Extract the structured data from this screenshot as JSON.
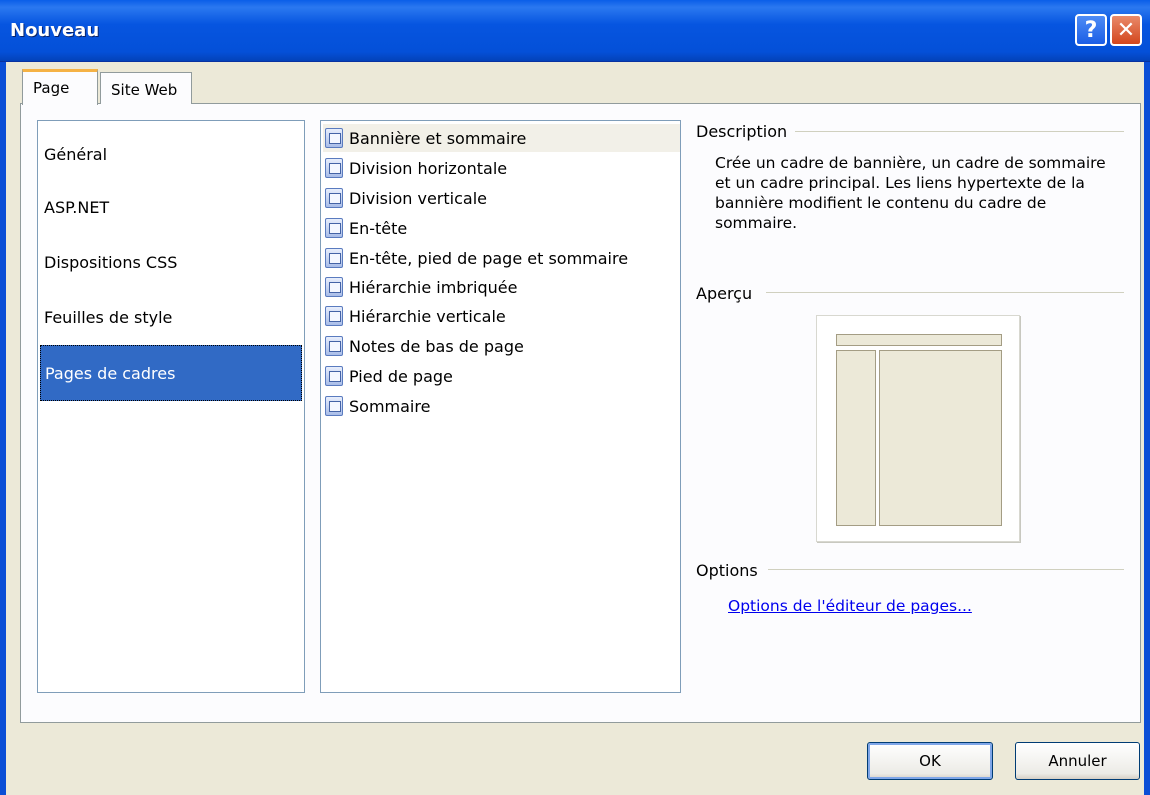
{
  "window": {
    "title": "Nouveau",
    "help_label": "?",
    "close_label": "✕"
  },
  "tabs": [
    {
      "label": "Page",
      "selected": true
    },
    {
      "label": "Site Web",
      "selected": false
    }
  ],
  "categories": [
    {
      "label": "Général",
      "selected": false
    },
    {
      "label": "ASP.NET",
      "selected": false
    },
    {
      "label": "Dispositions CSS",
      "selected": false
    },
    {
      "label": "Feuilles de style",
      "selected": false
    },
    {
      "label": "Pages de cadres",
      "selected": true
    }
  ],
  "templates": [
    {
      "label": "Bannière et sommaire",
      "icon": "frame-page-icon",
      "selected": true
    },
    {
      "label": "Division horizontale",
      "icon": "frame-page-icon"
    },
    {
      "label": "Division verticale",
      "icon": "frame-page-icon"
    },
    {
      "label": "En-tête",
      "icon": "frame-page-icon"
    },
    {
      "label": "En-tête, pied de page et sommaire",
      "icon": "frame-page-icon"
    },
    {
      "label": "Hiérarchie imbriquée",
      "icon": "frame-page-icon"
    },
    {
      "label": "Hiérarchie verticale",
      "icon": "frame-page-icon"
    },
    {
      "label": "Notes de bas de page",
      "icon": "frame-page-icon"
    },
    {
      "label": "Pied de page",
      "icon": "frame-page-icon"
    },
    {
      "label": "Sommaire",
      "icon": "frame-page-icon"
    }
  ],
  "description": {
    "heading": "Description",
    "text": "Crée un cadre de bannière, un cadre de sommaire et un cadre principal. Les liens hypertexte de la bannière modifient le contenu du cadre de sommaire."
  },
  "preview": {
    "heading": "Aperçu"
  },
  "options": {
    "heading": "Options",
    "link_label": "Options de l'éditeur de pages..."
  },
  "buttons": {
    "ok_label": "OK",
    "cancel_label": "Annuler"
  },
  "colors": {
    "titlebar": "#0655e0",
    "selection": "#316ac5",
    "link": "#0000ee"
  }
}
